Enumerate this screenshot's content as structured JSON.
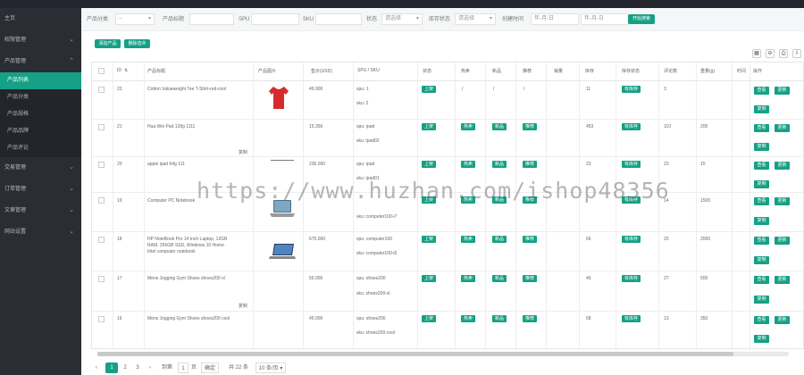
{
  "sidebar": {
    "items": [
      {
        "label": "主页"
      },
      {
        "label": "权限管理"
      },
      {
        "label": "产品管理"
      },
      {
        "label": "交易管理"
      },
      {
        "label": "订单管理"
      },
      {
        "label": "文章管理"
      },
      {
        "label": "网站设置"
      }
    ],
    "sub_items": [
      "产品列表",
      "产品分类",
      "产品规格",
      "产品品牌",
      "产品评论"
    ]
  },
  "filters": {
    "category_label": "产品分类",
    "category_value": "--",
    "title_label": "产品标题",
    "spu_label": "SPU",
    "sku_label": "SKU",
    "status_label": "状态",
    "status_value": "请选择",
    "stock_label": "库存状态",
    "stock_value": "请选择",
    "created_label": "创建时间",
    "date_from": "年-月-日",
    "date_to": "年-月-日",
    "search_button": "开始搜索"
  },
  "actions": {
    "add": "添加产品",
    "delete": "删除选中"
  },
  "table": {
    "headers": {
      "id": "ID",
      "image": "产品图片",
      "title": "产品标题",
      "price": "售价(USD)",
      "spu_sku": "SPU / SKU",
      "status": "状态",
      "hot": "热卖",
      "new": "新品",
      "rec": "推荐",
      "sales": "销量",
      "stock": "库存",
      "stock_status": "库存状态",
      "reviews": "评论数",
      "weight": "重量(g)",
      "more": "时间",
      "ops": "操作"
    },
    "rows": [
      {
        "id": "22",
        "title": [
          "Cotton Valueweight Tee T-Shirt-red-cool"
        ],
        "price": "49.900",
        "spu": "spu: 1",
        "sku": "sku: 2",
        "status": "上架",
        "hot": "/",
        "new": "/",
        "rec": "/",
        "stock": "11",
        "stock_status": "有库存",
        "reviews": "3",
        "weight": ""
      },
      {
        "id": "21",
        "title": [
          "Hua Wei Pad 128g 1111"
        ],
        "price": "15.356",
        "spu": "spu: ipad",
        "sku": "sku: ipad02",
        "status": "上架",
        "hot": "热卖",
        "new": "新品",
        "rec": "推荐",
        "stock": "453",
        "stock_status": "有库存",
        "reviews": "110",
        "weight": "200"
      },
      {
        "id": "20",
        "title": [
          "apple ipad 64g 111"
        ],
        "price": "236.000",
        "spu": "spu: ipad",
        "sku": "sku: ipad01",
        "status": "上架",
        "hot": "热卖",
        "new": "新品",
        "rec": "推荐",
        "stock": "23",
        "stock_status": "有库存",
        "reviews": "23",
        "weight": "15"
      },
      {
        "id": "19",
        "title": [
          "Computer PC Notebook"
        ],
        "price": "",
        "spu": "",
        "sku": "sku: computer100-i7",
        "status": "上架",
        "hot": "热卖",
        "new": "新品",
        "rec": "推荐",
        "stock": "",
        "stock_status": "有库存",
        "reviews": "14",
        "weight": "1500"
      },
      {
        "id": "18",
        "title": [
          "HP NoteBook Pro 14 Inch Laptop, 12GB",
          "RAM, 256GB SSD, Windows 10 Home",
          "Intel computer notebook"
        ],
        "price": "675.000",
        "spu": "spu: computer100",
        "sku": "sku: computer100-i5",
        "status": "上架",
        "hot": "热卖",
        "new": "新品",
        "rec": "推荐",
        "stock": "66",
        "stock_status": "有库存",
        "reviews": "20",
        "weight": "2000"
      },
      {
        "id": "17",
        "title": [
          "Mens Jogging Gym Shoes shoes200 xl"
        ],
        "price": "55.000",
        "spu": "spu: shoes200",
        "sku": "sku: shoes200-xl",
        "status": "上架",
        "hot": "热卖",
        "new": "新品",
        "rec": "推荐",
        "stock": "45",
        "stock_status": "有库存",
        "reviews": "27",
        "weight": "500"
      },
      {
        "id": "16",
        "title": [
          "Mens Jogging Gym Shoes shoes200 cool"
        ],
        "price": "45.000",
        "spu": "spu: shoes200",
        "sku": "sku: shoes200-cool",
        "status": "上架",
        "hot": "热卖",
        "new": "新品",
        "rec": "推荐",
        "stock": "58",
        "stock_status": "有库存",
        "reviews": "13",
        "weight": "350"
      }
    ],
    "copy_label": "复制",
    "op_view": "查看",
    "op_edit": "更新",
    "op_copy": "复制"
  },
  "pagination": {
    "pages": [
      "1",
      "2",
      "3"
    ],
    "goto": "到第",
    "page_input": "1",
    "page_unit": "页",
    "confirm": "确定",
    "total": "共 22 条",
    "per_page": "10 条/页"
  },
  "watermark": "https://www.huzhan.com/ishop48356",
  "colors": {
    "accent": "#16a085",
    "sidebar": "#2a2d33",
    "topbar": "#23262e"
  }
}
